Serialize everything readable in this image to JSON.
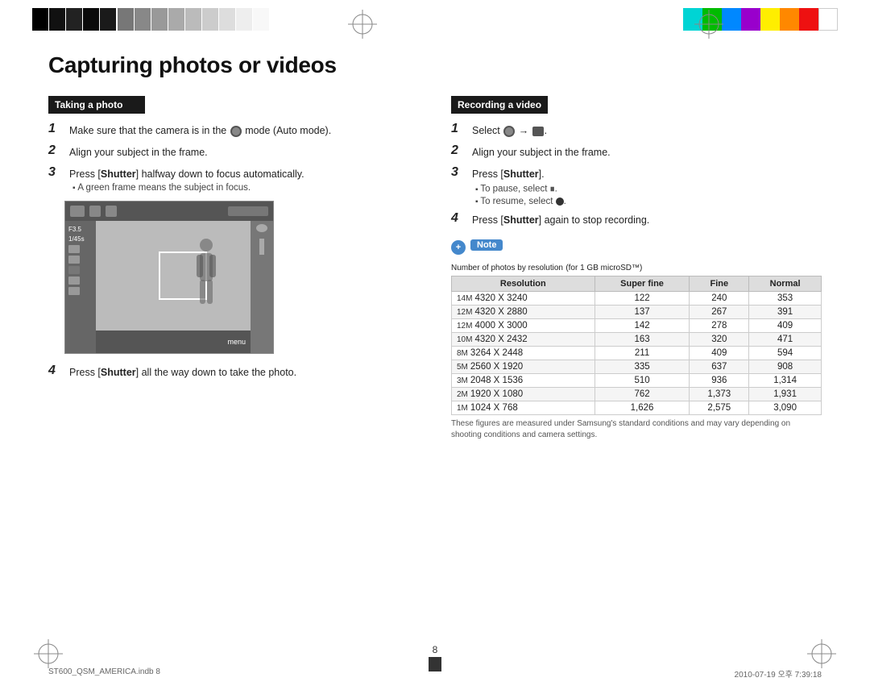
{
  "page": {
    "title": "Capturing photos or videos",
    "number": "8",
    "footer_left": "ST600_QSM_AMERICA.indb   8",
    "footer_right": "2010-07-19   오후 7:39:18"
  },
  "left_section": {
    "header": "Taking a photo",
    "steps": [
      {
        "num": "1",
        "text": "Make sure that the camera is in the  mode (Auto mode)."
      },
      {
        "num": "2",
        "text": "Align your subject in the frame."
      },
      {
        "num": "3",
        "text": "Press [Shutter] halfway down to focus automatically.",
        "sub": "A green frame means the subject in focus."
      },
      {
        "num": "4",
        "text": "Press [Shutter] all the way down to take the photo."
      }
    ],
    "camera_ui": {
      "top_left": "F3.5",
      "top_left2": "1/45s",
      "bottom_right": "menu"
    }
  },
  "right_section": {
    "header": "Recording a video",
    "steps": [
      {
        "num": "1",
        "text": "Select  → ."
      },
      {
        "num": "2",
        "text": "Align your subject in the frame."
      },
      {
        "num": "3",
        "text": "Press [Shutter].",
        "subs": [
          "To pause, select .",
          "To resume, select ."
        ]
      },
      {
        "num": "4",
        "text": "Press [Shutter] again to stop recording."
      }
    ],
    "note_label": "Note",
    "table": {
      "title": "Number of photos by resolution",
      "title_sub": "(for 1 GB microSD™)",
      "headers": [
        "Resolution",
        "Super fine",
        "Fine",
        "Normal"
      ],
      "rows": [
        {
          "icon": "14M",
          "res": "4320 X 3240",
          "sf": "122",
          "fine": "240",
          "normal": "353"
        },
        {
          "icon": "12M",
          "res": "4320 X 2880",
          "sf": "137",
          "fine": "267",
          "normal": "391"
        },
        {
          "icon": "12M",
          "res": "4000 X 3000",
          "sf": "142",
          "fine": "278",
          "normal": "409"
        },
        {
          "icon": "10M",
          "res": "4320 X 2432",
          "sf": "163",
          "fine": "320",
          "normal": "471"
        },
        {
          "icon": "8M",
          "res": "3264 X 2448",
          "sf": "211",
          "fine": "409",
          "normal": "594"
        },
        {
          "icon": "5M",
          "res": "2560 X 1920",
          "sf": "335",
          "fine": "637",
          "normal": "908"
        },
        {
          "icon": "3M",
          "res": "2048 X 1536",
          "sf": "510",
          "fine": "936",
          "normal": "1,314"
        },
        {
          "icon": "2M",
          "res": "1920 X 1080",
          "sf": "762",
          "fine": "1,373",
          "normal": "1,931"
        },
        {
          "icon": "1M",
          "res": "1024 X 768",
          "sf": "1,626",
          "fine": "2,575",
          "normal": "3,090"
        }
      ],
      "footnote": "These figures are measured under Samsung's standard conditions and may vary depending on shooting conditions and camera settings."
    }
  },
  "colors": {
    "black_squares": [
      "#000000",
      "#1a1a1a",
      "#2a2a2a",
      "#111111",
      "#0d0d0d"
    ],
    "gray_squares": [
      "#888888",
      "#999999",
      "#aaaaaa",
      "#bbbbbb",
      "#cccccc",
      "#dddddd",
      "#eeeeee",
      "#ffffff"
    ],
    "color_strip": [
      "#00d0d0",
      "#00c000",
      "#00a0ff",
      "#a000ff",
      "#ffff00",
      "#ff8000",
      "#ff0000",
      "#ffffff"
    ]
  }
}
